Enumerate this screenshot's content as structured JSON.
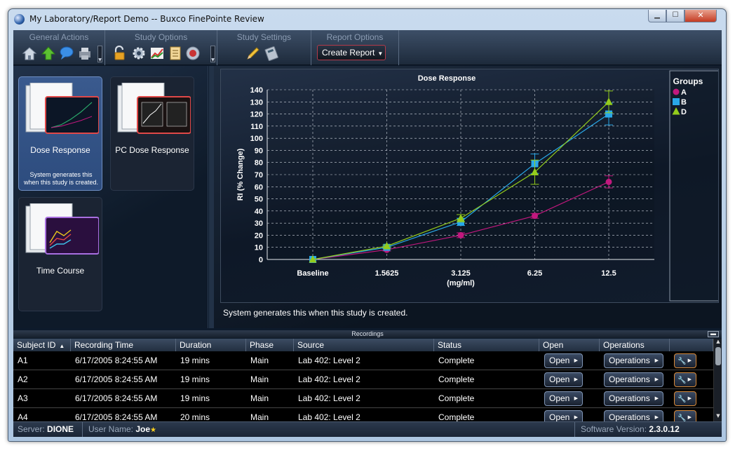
{
  "window": {
    "title": "My Laboratory/Report Demo -- Buxco FinePointe Review",
    "controls": {
      "minimize": "▁",
      "maximize": "☐",
      "close": "✕"
    }
  },
  "toolbar": {
    "groups": [
      {
        "label": "General Actions",
        "icons": [
          "home-icon",
          "upload-arrow-icon",
          "chat-bubble-icon",
          "printer-icon"
        ]
      },
      {
        "label": "Study Options",
        "icons": [
          "unlock-icon",
          "gear-icon",
          "chart-grid-icon",
          "document-stack-icon",
          "gauge-icon"
        ]
      },
      {
        "label": "Study Settings",
        "icons": [
          "pencil-icon",
          "calculator-icon"
        ]
      },
      {
        "label": "Report Options",
        "button": "Create Report"
      }
    ]
  },
  "reports": [
    {
      "title": "Dose Response",
      "desc": "System generates this when this study is created.",
      "selected": true
    },
    {
      "title": "PC Dose Response",
      "desc": "",
      "selected": false
    },
    {
      "title": "Time Course",
      "desc": "",
      "selected": false
    }
  ],
  "chart_description": "System generates this when this study is created.",
  "chart_data": {
    "type": "line",
    "title": "Dose Response",
    "xlabel": "(mg/ml)",
    "x_center_label": "3.125",
    "ylabel": "RI (% Change)",
    "categories": [
      "Baseline",
      "1.5625",
      "3.125",
      "6.25",
      "12.5"
    ],
    "ylim": [
      0,
      140
    ],
    "yticks": [
      0,
      10,
      20,
      30,
      40,
      50,
      60,
      70,
      80,
      90,
      100,
      110,
      120,
      130,
      140
    ],
    "grid": true,
    "legend_title": "Groups",
    "legend_position": "right",
    "series": [
      {
        "name": "A",
        "color": "#c2187e",
        "marker": "circle",
        "values": [
          0,
          8,
          20,
          36,
          64
        ],
        "err": [
          0,
          1,
          2,
          2,
          5
        ]
      },
      {
        "name": "B",
        "color": "#29a8e8",
        "marker": "square",
        "values": [
          0,
          10,
          31,
          79,
          120
        ],
        "err": [
          0,
          1,
          3,
          8,
          9
        ]
      },
      {
        "name": "D",
        "color": "#94cc1c",
        "marker": "triangle",
        "values": [
          0,
          11,
          34,
          72,
          130
        ],
        "err": [
          0,
          1,
          3,
          10,
          9
        ]
      }
    ]
  },
  "recordings": {
    "title": "Recordings",
    "collapse": "▬",
    "columns": [
      "Subject ID",
      "Recording Time",
      "Duration",
      "Phase",
      "Source",
      "Status",
      "Open",
      "Operations",
      ""
    ],
    "sort_indicator": "▲",
    "open_label": "Open",
    "operations_label": "Operations",
    "tool_glyph": "🔧",
    "arrow_glyph": "▶",
    "rows": [
      {
        "id": "A1",
        "time": "6/17/2005 8:24:55 AM",
        "duration": "19 mins",
        "phase": "Main",
        "source": "Lab 402: Level 2",
        "status": "Complete"
      },
      {
        "id": "A2",
        "time": "6/17/2005 8:24:55 AM",
        "duration": "19 mins",
        "phase": "Main",
        "source": "Lab 402: Level 2",
        "status": "Complete"
      },
      {
        "id": "A3",
        "time": "6/17/2005 8:24:55 AM",
        "duration": "19 mins",
        "phase": "Main",
        "source": "Lab 402: Level 2",
        "status": "Complete"
      },
      {
        "id": "A4",
        "time": "6/17/2005 8:24:55 AM",
        "duration": "20 mins",
        "phase": "Main",
        "source": "Lab 402: Level 2",
        "status": "Complete"
      }
    ]
  },
  "status": {
    "server_label": "Server:",
    "server": "DIONE",
    "user_label": "User Name:",
    "user": "Joe",
    "star": "★",
    "version_label": "Software Version:",
    "version": "2.3.0.12"
  }
}
